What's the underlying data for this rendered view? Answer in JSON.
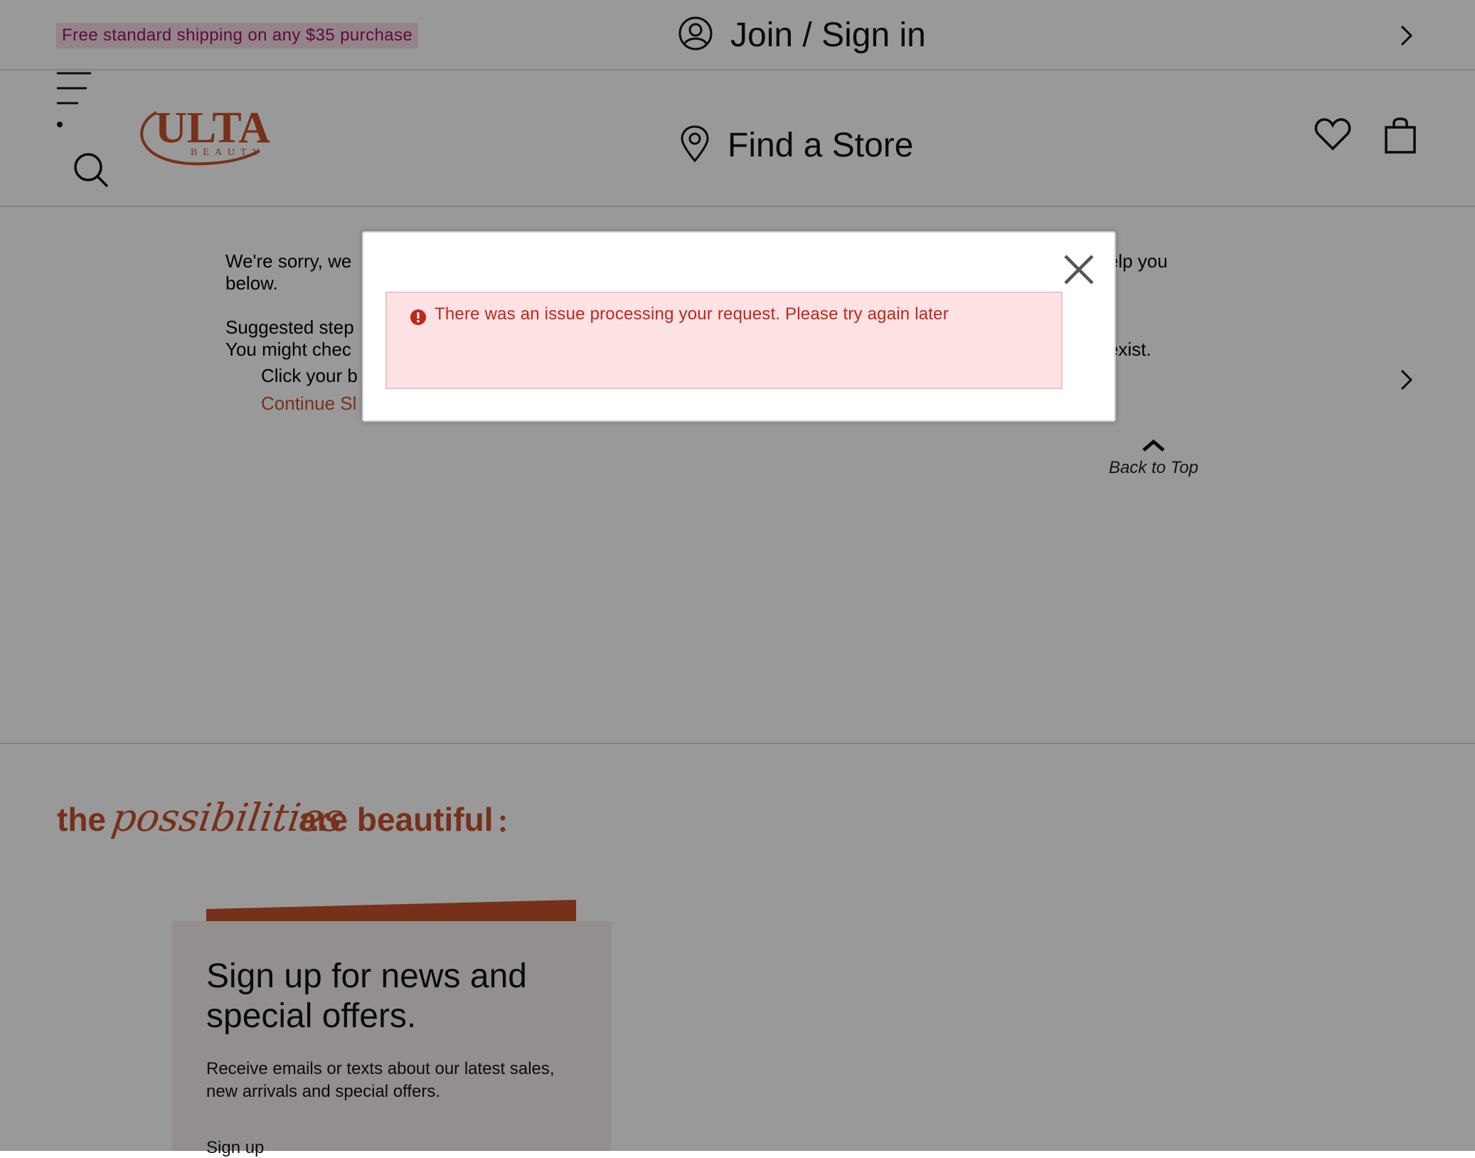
{
  "promo": {
    "text": "Free standard shipping on any $35 purchase"
  },
  "account": {
    "join_label": "Join / Sign in"
  },
  "header": {
    "logo_text": "ULTA",
    "logo_sub": "BEAUTY",
    "store_label": "Find a Store"
  },
  "content": {
    "sorry_left": "We're sorry, we",
    "sorry_right": "elp you",
    "sorry_line2": "below.",
    "steps_line1": "Suggested step",
    "steps_line2": "You might chec",
    "steps_right": "exist.",
    "click_text": "Click your b",
    "continue_text": "Continue Sl",
    "back_to_top": "Back to Top"
  },
  "footer": {
    "tagline_the": "the",
    "tagline_script": "possibilities",
    "tagline_rest": "are beautiful",
    "signup_title": "Sign up for news and special offers.",
    "signup_desc": "Receive emails or texts about our latest sales, new arrivals and special offers.",
    "signup_link": "Sign up"
  },
  "modal": {
    "error_message": "There was an issue processing your request. Please try again later"
  },
  "colors": {
    "brand_orange": "#c6502a",
    "promo_text": "#a0135a",
    "error_text": "#c0261b",
    "error_bg": "#ffe2e4"
  },
  "icons": {
    "account": "user-circle-icon",
    "menu": "hamburger-icon",
    "search": "search-icon",
    "store": "map-pin-icon",
    "wishlist": "heart-icon",
    "bag": "shopping-bag-icon",
    "close": "close-icon",
    "alert": "exclamation-circle-icon"
  }
}
